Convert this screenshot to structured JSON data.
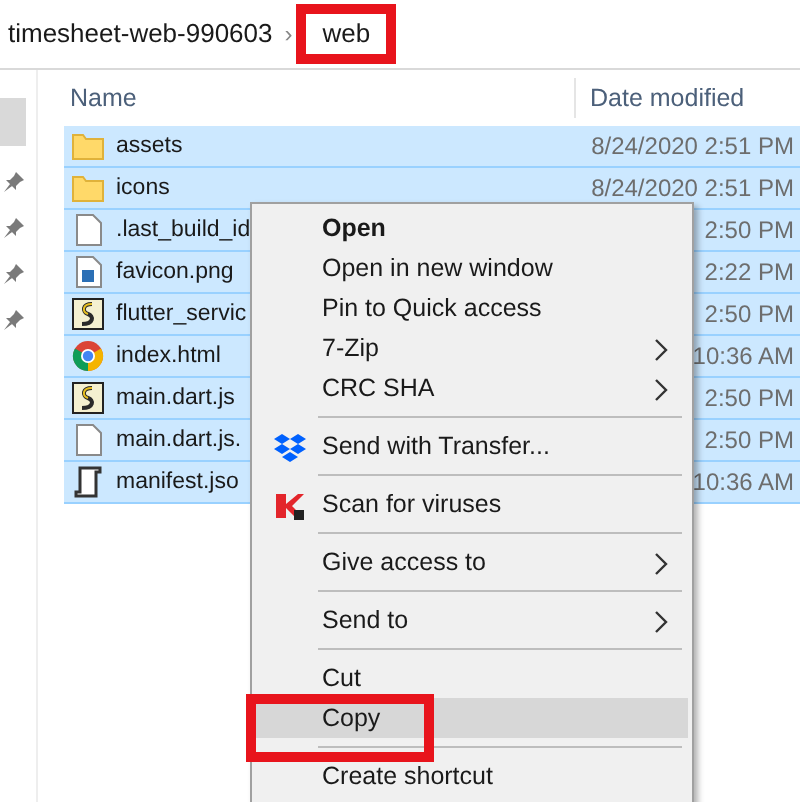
{
  "address_bar": {
    "crumbs": [
      {
        "label": "timesheet-web-990603",
        "annotated": false
      },
      {
        "label": "web",
        "annotated": true
      }
    ],
    "separator": "›"
  },
  "nav_pane": {
    "items": [
      {
        "kind": "selected-block"
      },
      {
        "kind": "pin"
      },
      {
        "kind": "pin"
      },
      {
        "kind": "pin"
      },
      {
        "kind": "pin"
      }
    ]
  },
  "columns": [
    "Name",
    "Date modified"
  ],
  "files": [
    {
      "name": "assets",
      "kind": "folder",
      "date": "8/24/2020 2:51 PM",
      "selected": true
    },
    {
      "name": "icons",
      "kind": "folder",
      "date": "8/24/2020 2:51 PM",
      "selected": true
    },
    {
      "name": ".last_build_id",
      "kind": "file",
      "date": "2:50 PM",
      "selected": true
    },
    {
      "name": "favicon.png",
      "kind": "image",
      "date": "2:22 PM",
      "selected": true
    },
    {
      "name": "flutter_servic",
      "kind": "script",
      "date": "2:50 PM",
      "selected": true
    },
    {
      "name": "index.html",
      "kind": "browser",
      "date": "10:36 AM",
      "selected": true
    },
    {
      "name": "main.dart.js",
      "kind": "script",
      "date": "2:50 PM",
      "selected": true
    },
    {
      "name": "main.dart.js.",
      "kind": "file",
      "date": "2:50 PM",
      "selected": true
    },
    {
      "name": "manifest.jso",
      "kind": "json",
      "date": "10:36 AM",
      "selected": true
    }
  ],
  "context_menu": [
    {
      "kind": "item",
      "label": "Open",
      "default": true,
      "submenu": false,
      "selected": false,
      "annotated": false
    },
    {
      "kind": "item",
      "label": "Open in new window",
      "default": false,
      "submenu": false,
      "selected": false,
      "annotated": false
    },
    {
      "kind": "item",
      "label": "Pin to Quick access",
      "default": false,
      "submenu": false,
      "selected": false,
      "annotated": false
    },
    {
      "kind": "item",
      "label": "7-Zip",
      "default": false,
      "submenu": true,
      "selected": false,
      "annotated": false
    },
    {
      "kind": "item",
      "label": "CRC SHA",
      "default": false,
      "submenu": true,
      "selected": false,
      "annotated": false
    },
    {
      "kind": "separator"
    },
    {
      "kind": "share",
      "label": "Send with Transfer...",
      "default": false,
      "submenu": false,
      "selected": false,
      "annotated": false
    },
    {
      "kind": "separator"
    },
    {
      "kind": "scan",
      "label": "Scan for viruses",
      "default": false,
      "submenu": false,
      "selected": false,
      "annotated": false
    },
    {
      "kind": "separator"
    },
    {
      "kind": "item",
      "label": "Give access to",
      "default": false,
      "submenu": true,
      "selected": false,
      "annotated": false
    },
    {
      "kind": "separator"
    },
    {
      "kind": "item",
      "label": "Send to",
      "default": false,
      "submenu": true,
      "selected": false,
      "annotated": false
    },
    {
      "kind": "separator"
    },
    {
      "kind": "item",
      "label": "Cut",
      "default": false,
      "submenu": false,
      "selected": false,
      "annotated": false
    },
    {
      "kind": "item",
      "label": "Copy",
      "default": false,
      "submenu": false,
      "selected": true,
      "annotated": true
    },
    {
      "kind": "separator"
    },
    {
      "kind": "item",
      "label": "Create shortcut",
      "default": false,
      "submenu": false,
      "selected": false,
      "annotated": false
    }
  ]
}
